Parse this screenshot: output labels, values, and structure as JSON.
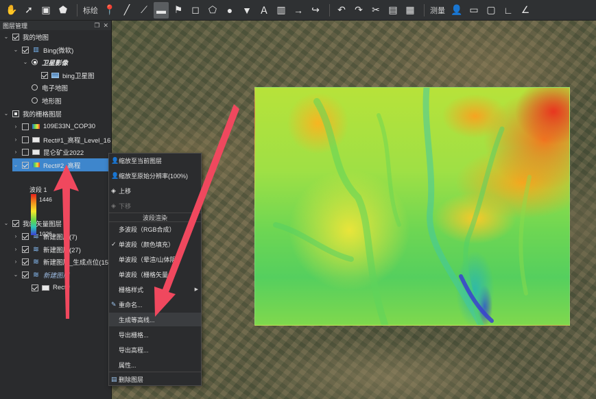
{
  "toolbar": {
    "label_mark": "标绘",
    "label_measure": "测量"
  },
  "panel": {
    "title": "图层管理",
    "items": [
      {
        "label": "我的地图"
      },
      {
        "label": "Bing(微软)"
      },
      {
        "label": "卫星影像"
      },
      {
        "label": "bing卫星图"
      },
      {
        "label": "电子地图"
      },
      {
        "label": "地形图"
      },
      {
        "label": "我的栅格图层"
      },
      {
        "label": "109E33N_COP30"
      },
      {
        "label": "Rect#1_高程_Level_16"
      },
      {
        "label": "昆仑矿业2022"
      },
      {
        "label": "Rect#2_高程"
      },
      {
        "label": "我的矢量图层"
      },
      {
        "label": "新建图层(7)"
      },
      {
        "label": "新建图层(27)"
      },
      {
        "label": "新建图层_生成点位(15)"
      },
      {
        "label": "新建图层"
      },
      {
        "label": "Rect#"
      }
    ],
    "legend": {
      "band": "波段 1",
      "max": "1446",
      "min": "1026"
    }
  },
  "menu": {
    "zoom_layer": "缩放至当前图层",
    "zoom_native": "缩放至原始分辨率(100%)",
    "move_up": "上移",
    "move_down": "下移",
    "band_header": "波段渲染",
    "multiband": "多波段（RGB合成）",
    "singleband_color": "单波段（颜色填充）",
    "singleband_hillshade": "单波段（晕渲/山体阴",
    "singleband_vector": "单波段（栅格矢量化",
    "raster_style": "栅格样式",
    "rename": "重命名...",
    "gen_contour": "生成等高线...",
    "export_raster": "导出栅格...",
    "export_elevation": "导出高程...",
    "properties": "属性...",
    "delete_layer": "删除图层"
  },
  "colors": {
    "accent": "#3e86cc",
    "annotation_arrow": "#f0485e"
  }
}
